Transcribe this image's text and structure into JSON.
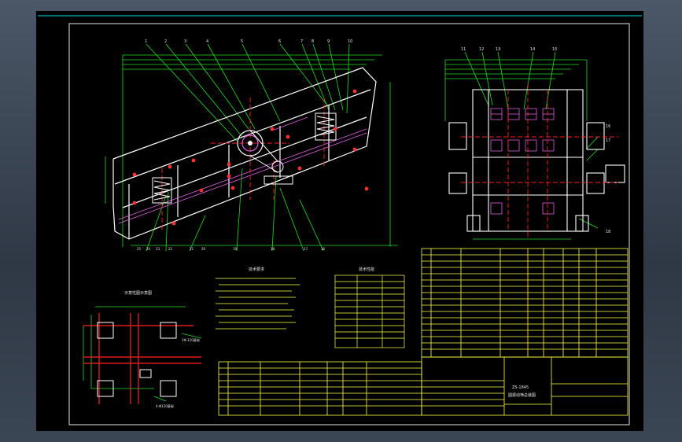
{
  "drawing": {
    "view_titles": {
      "tech_requirements": "技术要求",
      "tech_specs": "技术性能",
      "foundation": "示意性图示意图"
    },
    "part_callouts_main": [
      "1",
      "2",
      "3",
      "4",
      "5",
      "6",
      "7",
      "8",
      "9",
      "10"
    ],
    "part_callouts_side": [
      "11",
      "12",
      "13",
      "14",
      "15",
      "16",
      "17",
      "18"
    ],
    "foundation_notes": [
      "1Φ-120基础",
      "4-Φ120基础"
    ],
    "title_block": {
      "name": "ZS-1845",
      "subtitle": "圆振动筛总装图",
      "header_labels": [
        "标记",
        "处数",
        "分区",
        "更改文件号",
        "签名",
        "年月日"
      ],
      "rows": [
        "设计",
        "审核",
        "工艺"
      ],
      "right_labels": [
        "阶段标记",
        "重量",
        "比例"
      ],
      "bottom": [
        "共",
        "张",
        "第",
        "张"
      ]
    },
    "bom_header": [
      "序号",
      "代号",
      "名称",
      "数量",
      "材料",
      "单件",
      "总计",
      "备注"
    ],
    "colors": {
      "background": "#000000",
      "frame": "#e6e6e6",
      "outline": "#ffffff",
      "centerline": "#ff2020",
      "dimension": "#22dd22",
      "hatch": "#e060e0",
      "table": "#ffff40",
      "accent": "#00e5e5"
    }
  }
}
